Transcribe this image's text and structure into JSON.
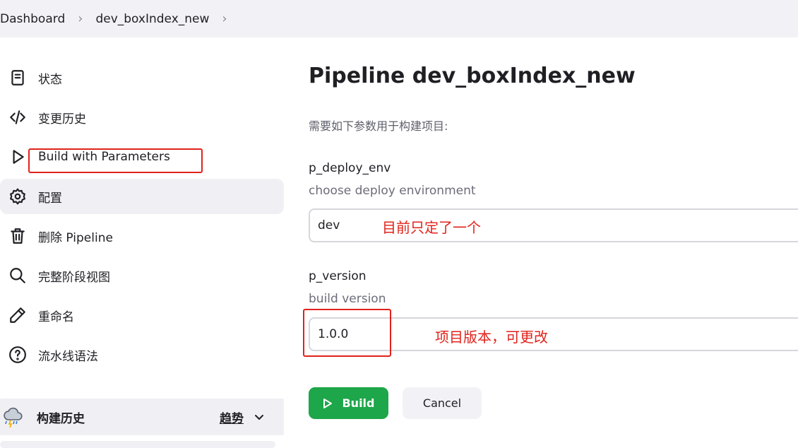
{
  "breadcrumb": {
    "items": [
      "Dashboard",
      "dev_boxIndex_new"
    ],
    "separator": ">"
  },
  "sidebar": {
    "items": [
      {
        "label": "状态",
        "icon": "document-icon"
      },
      {
        "label": "变更历史",
        "icon": "code-icon"
      },
      {
        "label": "Build with Parameters",
        "icon": "play-icon"
      },
      {
        "label": "配置",
        "icon": "gear-icon"
      },
      {
        "label": "删除 Pipeline",
        "icon": "trash-icon"
      },
      {
        "label": "完整阶段视图",
        "icon": "search-icon"
      },
      {
        "label": "重命名",
        "icon": "pencil-icon"
      },
      {
        "label": "流水线语法",
        "icon": "help-icon"
      }
    ],
    "active_index": 3
  },
  "build_history": {
    "title": "构建历史",
    "trend_label": "趋势",
    "icon": "weather-cloud-icon"
  },
  "main": {
    "title": "Pipeline dev_boxIndex_new",
    "intro": "需要如下参数用于构建项目:",
    "params": [
      {
        "name": "p_deploy_env",
        "description": "choose deploy environment",
        "value": "dev",
        "annotation": "目前只定了一个"
      },
      {
        "name": "p_version",
        "description": "build version",
        "value": "1.0.0",
        "annotation": "项目版本，可更改"
      }
    ],
    "build_label": "Build",
    "cancel_label": "Cancel"
  },
  "colors": {
    "annotation": "#e0221b",
    "build_button": "#1ea64a",
    "breadcrumb_bg": "#f2f2f6"
  }
}
